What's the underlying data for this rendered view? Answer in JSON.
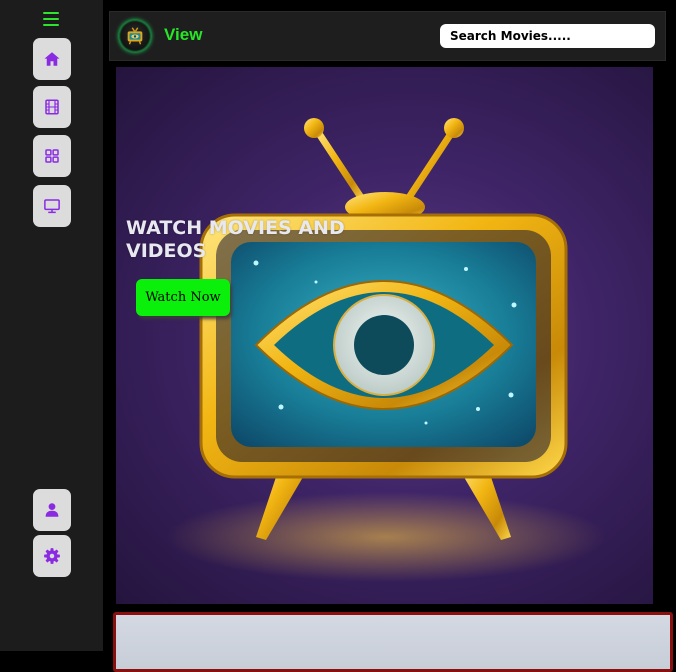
{
  "sidebar": {
    "toggle_icon": "hamburger-icon",
    "nav_items": [
      {
        "icon": "home-icon",
        "label": "Home"
      },
      {
        "icon": "film-icon",
        "label": "Movies"
      },
      {
        "icon": "grid-icon",
        "label": "Categories"
      },
      {
        "icon": "tv-icon",
        "label": "TV"
      }
    ],
    "bottom_items": [
      {
        "icon": "user-icon",
        "label": "Profile"
      },
      {
        "icon": "gear-icon",
        "label": "Settings"
      }
    ],
    "icon_color": "#8a2be2",
    "toggle_color": "#2ee52e"
  },
  "header": {
    "brand": "View",
    "brand_color": "#27e527",
    "search_placeholder": "Search Movies....."
  },
  "hero": {
    "title": "WATCH MOVIES AND VIDEOS",
    "cta_label": "Watch Now",
    "cta_color": "#0bf00b"
  }
}
